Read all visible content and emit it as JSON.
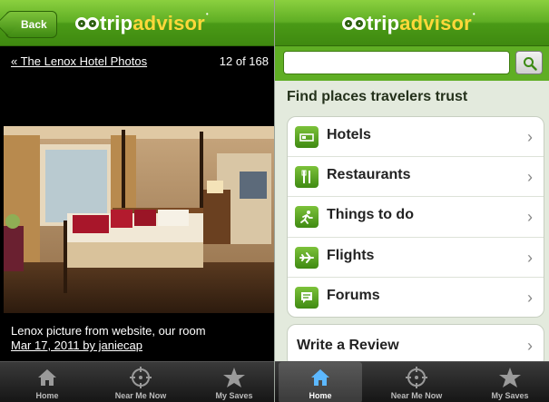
{
  "brand": {
    "word1": "trip",
    "word2": "advisor",
    "tm": "•"
  },
  "left": {
    "back_label": "Back",
    "photos_link": "« The Lenox Hotel Photos",
    "counter": "12 of 168",
    "caption": "Lenox picture from website, our room",
    "caption_date": "Mar 17, 2011 by janiecap",
    "tabs": [
      {
        "label": "Home",
        "icon": "home-icon"
      },
      {
        "label": "Near Me Now",
        "icon": "crosshair-icon"
      },
      {
        "label": "My Saves",
        "icon": "star-icon"
      }
    ]
  },
  "right": {
    "search_placeholder": "",
    "heading": "Find places travelers trust",
    "menu": [
      {
        "label": "Hotels",
        "icon": "bed-icon"
      },
      {
        "label": "Restaurants",
        "icon": "fork-knife-icon"
      },
      {
        "label": "Things to do",
        "icon": "running-person-icon"
      },
      {
        "label": "Flights",
        "icon": "airplane-icon"
      },
      {
        "label": "Forums",
        "icon": "speech-bubble-icon"
      }
    ],
    "review_label": "Write a Review",
    "chevron": "›",
    "tabs": [
      {
        "label": "Home",
        "icon": "home-icon",
        "active": true
      },
      {
        "label": "Near Me Now",
        "icon": "crosshair-icon"
      },
      {
        "label": "My Saves",
        "icon": "star-icon"
      }
    ]
  },
  "colors": {
    "brand_green": "#5fae24",
    "brand_yellow": "#ffd83a",
    "tab_dark": "#1f1f1f"
  }
}
